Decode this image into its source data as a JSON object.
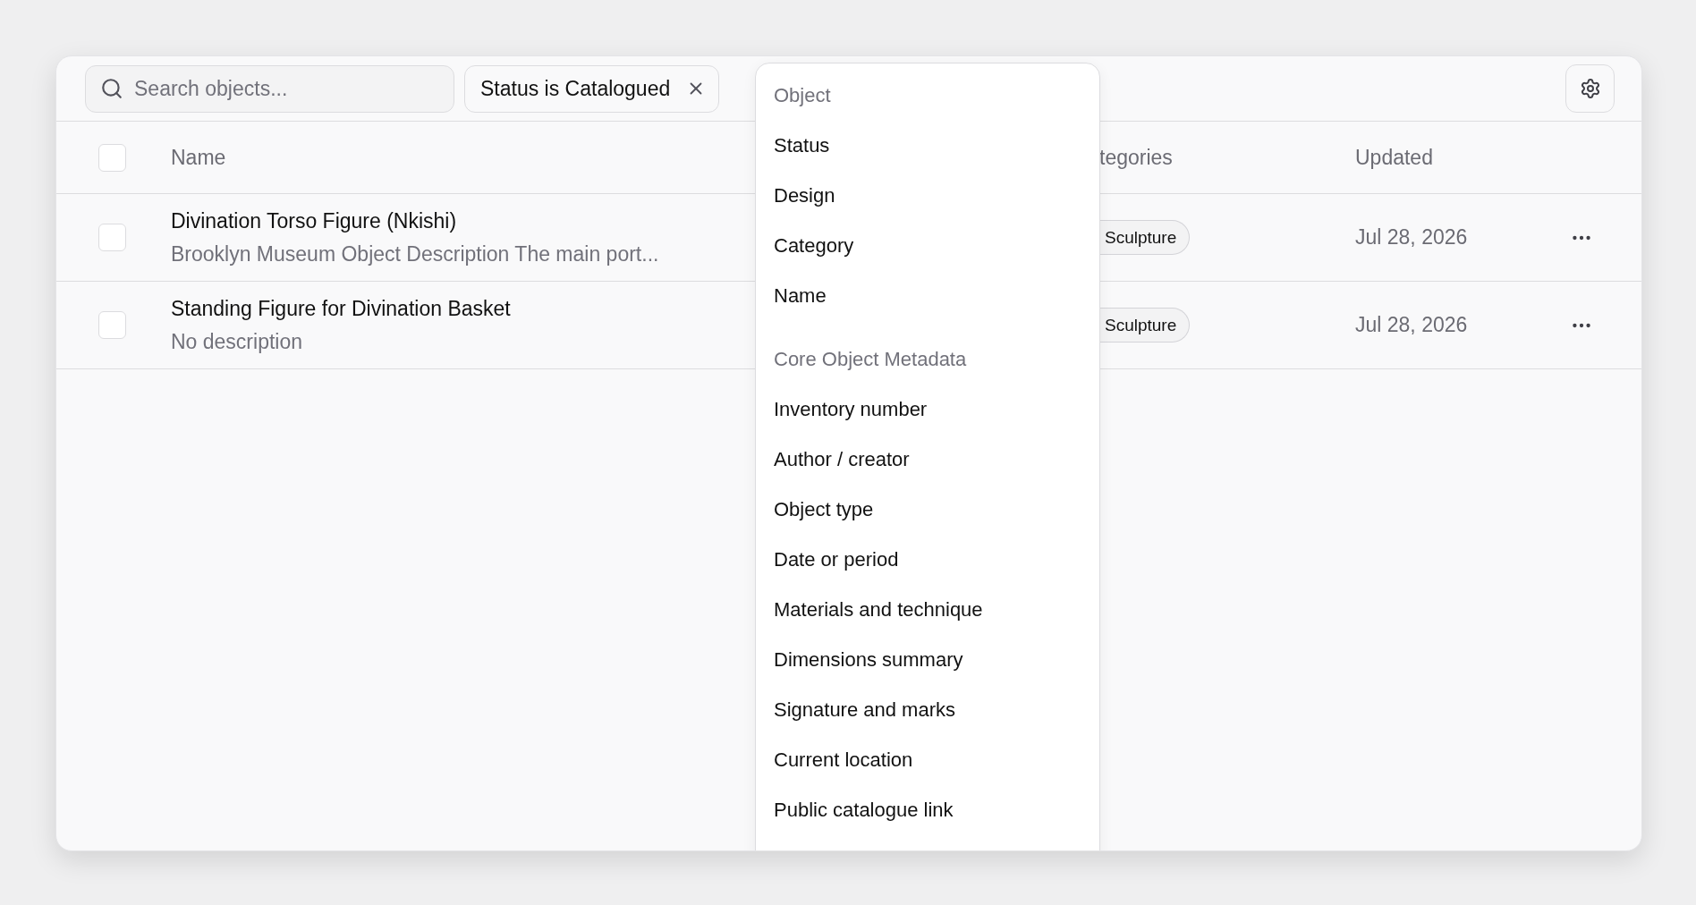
{
  "search": {
    "placeholder": "Search objects..."
  },
  "filter_chip": {
    "label": "Status is Catalogued"
  },
  "table": {
    "header_checkbox": {
      "checked": false
    },
    "columns": [
      "Name",
      "tegories",
      "Updated"
    ],
    "rows": [
      {
        "checked": false,
        "name": "Divination Torso Figure (Nkishi)",
        "description": "Brooklyn Museum Object Description The main port...",
        "category": "Sculpture",
        "updated": "Jul 28, 2026"
      },
      {
        "checked": false,
        "name": "Standing Figure for Divination Basket",
        "description": "No description",
        "category": "Sculpture",
        "updated": "Jul 28, 2026"
      }
    ]
  },
  "field_menu": {
    "groups": [
      {
        "heading": "Object",
        "items": [
          "Status",
          "Design",
          "Category",
          "Name"
        ]
      },
      {
        "heading": "Core Object Metadata",
        "items": [
          "Inventory number",
          "Author / creator",
          "Object type",
          "Date or period",
          "Materials and technique",
          "Dimensions summary",
          "Signature and marks",
          "Current location",
          "Public catalogue link"
        ]
      }
    ]
  }
}
